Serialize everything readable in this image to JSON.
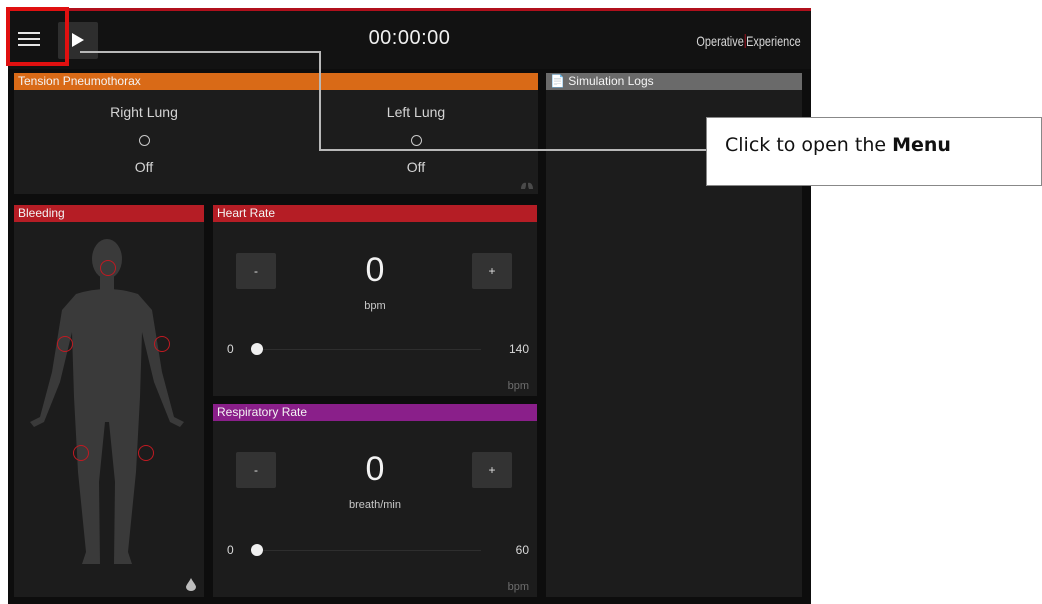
{
  "topbar": {
    "timer": "00:00:00",
    "brand_part1": "Operative",
    "brand_part2": "Experience"
  },
  "tension": {
    "title": "Tension Pneumothorax",
    "right_lung": {
      "label": "Right Lung",
      "state": "Off"
    },
    "left_lung": {
      "label": "Left Lung",
      "state": "Off"
    }
  },
  "logs": {
    "title": "📄 Simulation Logs"
  },
  "bleeding": {
    "title": "Bleeding"
  },
  "heart_rate": {
    "title": "Heart Rate",
    "minus": "-",
    "plus": "+",
    "value": "0",
    "unit": "bpm",
    "min": "0",
    "max": "140",
    "corner_unit": "bpm"
  },
  "resp_rate": {
    "title": "Respiratory Rate",
    "minus": "-",
    "plus": "+",
    "value": "0",
    "unit": "breath/min",
    "min": "0",
    "max": "60",
    "corner_unit": "bpm"
  },
  "callout": {
    "text": "Click to open the ",
    "bold": "Menu"
  },
  "colors": {
    "tension": "#d96a17",
    "bleeding": "#b51d25",
    "heart_rate": "#b51d25",
    "resp_rate": "#8a1f8a",
    "logs": "#6a6a6a",
    "highlight": "#e01010"
  }
}
